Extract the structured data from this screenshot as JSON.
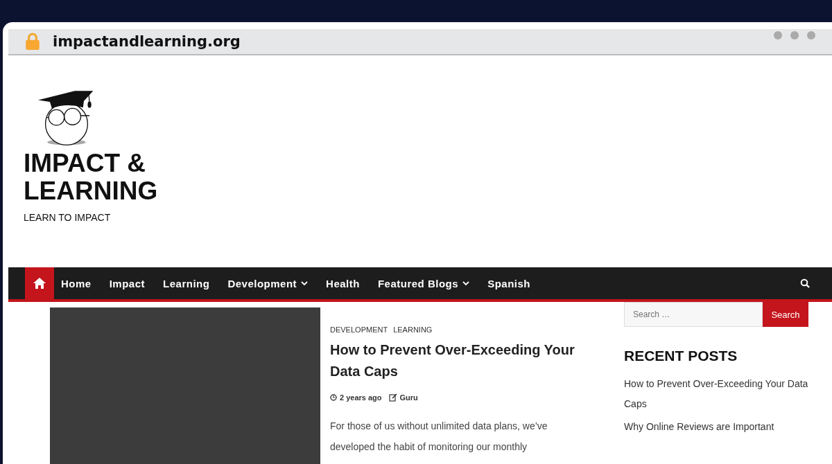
{
  "browser": {
    "url": "impactandlearning.org"
  },
  "site": {
    "title_lines": [
      "IMPACT &",
      "LEARNING"
    ],
    "tagline": "LEARN TO IMPACT"
  },
  "nav": {
    "items": [
      {
        "label": "Home",
        "dropdown": false
      },
      {
        "label": "Impact",
        "dropdown": false
      },
      {
        "label": "Learning",
        "dropdown": false
      },
      {
        "label": "Development",
        "dropdown": true
      },
      {
        "label": "Health",
        "dropdown": false
      },
      {
        "label": "Featured Blogs",
        "dropdown": true
      },
      {
        "label": "Spanish",
        "dropdown": false
      }
    ]
  },
  "article": {
    "categories": [
      "DEVELOPMENT",
      "LEARNING"
    ],
    "title": "How to Prevent Over-Exceeding Your Data Caps",
    "date": "2 years ago",
    "author": "Guru",
    "excerpt_lines": [
      "For those of us without unlimited data plans, we’ve",
      "developed the habit of monitoring our monthly"
    ]
  },
  "sidebar": {
    "search": {
      "placeholder": "Search …",
      "button": "Search"
    },
    "recent_title": "RECENT POSTS",
    "recent_posts": [
      "How to Prevent Over-Exceeding Your Data Caps",
      "Why Online Reviews are Important"
    ]
  }
}
